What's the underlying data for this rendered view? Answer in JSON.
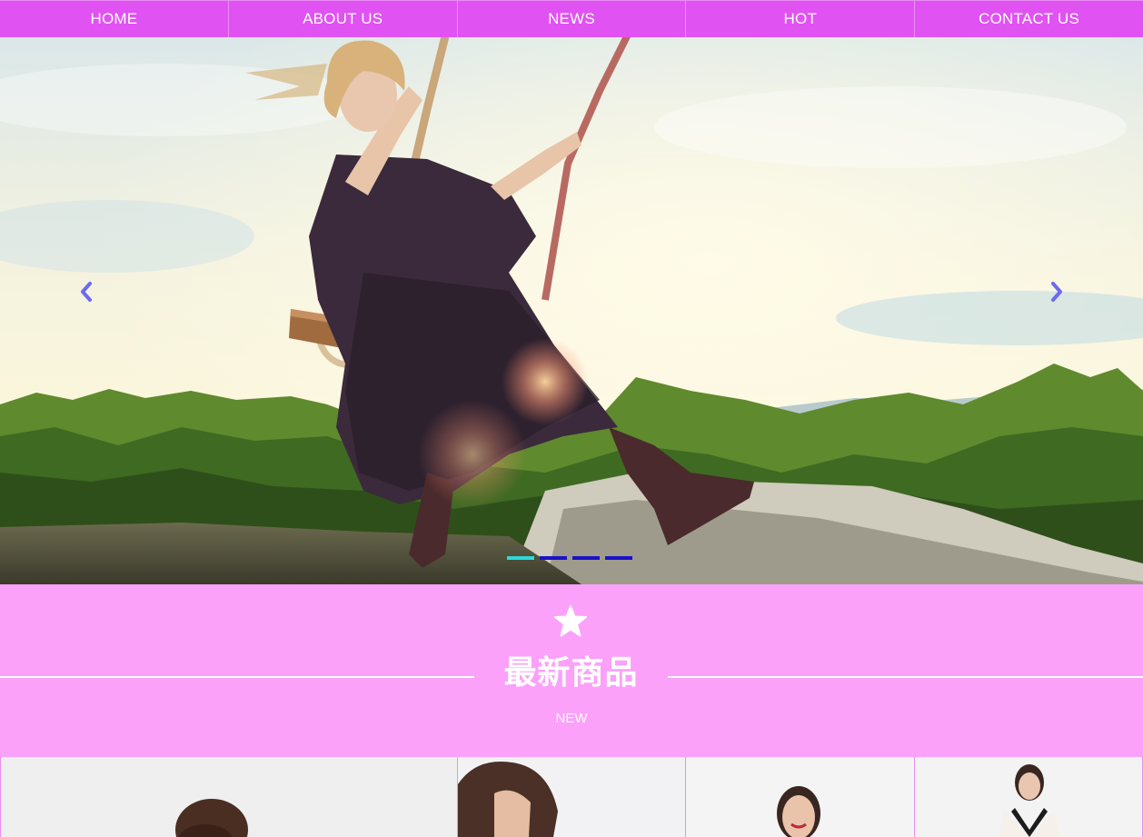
{
  "nav": {
    "items": [
      "HOME",
      "ABOUT US",
      "NEWS",
      "HOT",
      "CONTACT US"
    ]
  },
  "hero": {
    "slide_count": 4,
    "active_slide": 1,
    "prev_icon": "chevron-left-icon",
    "next_icon": "chevron-right-icon"
  },
  "section": {
    "icon": "star-icon",
    "title": "最新商品",
    "subtitle": "NEW"
  },
  "colors": {
    "nav_bg": "#e152f2",
    "section_bg": "#fba1fa",
    "dot_active": "#2ed8d8",
    "dot_inactive": "#1a12c8",
    "arrow": "#6b6bf0"
  }
}
